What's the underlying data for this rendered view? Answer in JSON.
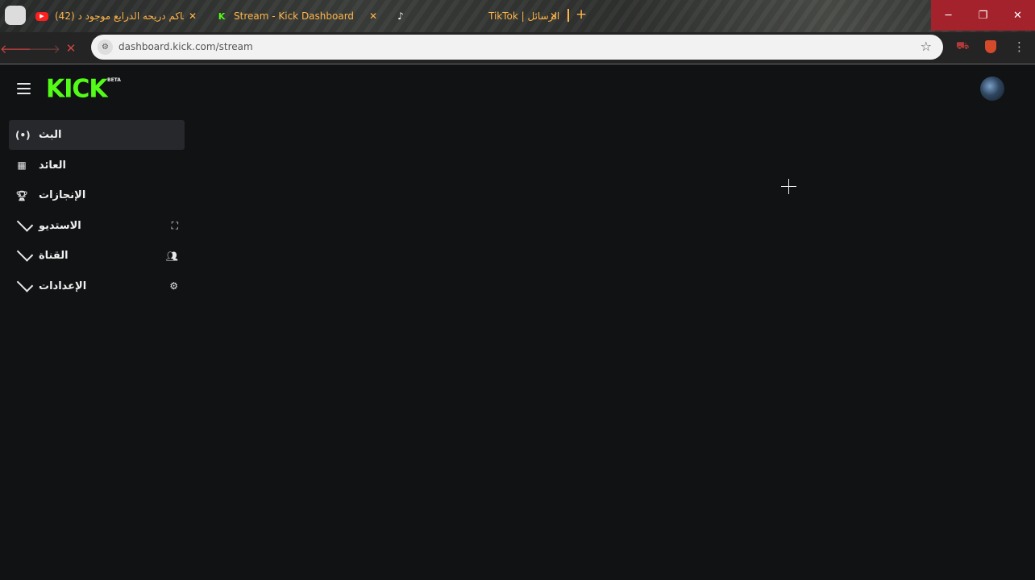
{
  "browser": {
    "tabs": [
      {
        "title": "(42) الحاكم دريحه الدرايع موجود د",
        "favicon": "youtube-icon"
      },
      {
        "title": "Stream - Kick Dashboard",
        "favicon": "kick-icon"
      },
      {
        "title": "TikTok | الرسائل",
        "favicon": "tiktok-icon"
      }
    ],
    "new_tab": "+",
    "window": {
      "minimize": "─",
      "maximize": "❐",
      "close": "✕"
    },
    "url": "dashboard.kick.com/stream",
    "accent": "#ffb54a"
  },
  "app": {
    "logo": "KICK",
    "logo_badge": "BETA",
    "brand_color": "#53fc18",
    "nav": [
      {
        "label": "البث",
        "icon": "broadcast-icon",
        "active": true
      },
      {
        "label": "العائد",
        "icon": "chart-icon",
        "active": false
      },
      {
        "label": "الإنجازات",
        "icon": "trophy-icon",
        "active": false
      },
      {
        "label": "الاستديو",
        "icon": "studio-icon",
        "expandable": true
      },
      {
        "label": "القناة",
        "icon": "users-icon",
        "expandable": true
      },
      {
        "label": "الإعدادات",
        "icon": "gear-icon",
        "expandable": true
      }
    ]
  }
}
